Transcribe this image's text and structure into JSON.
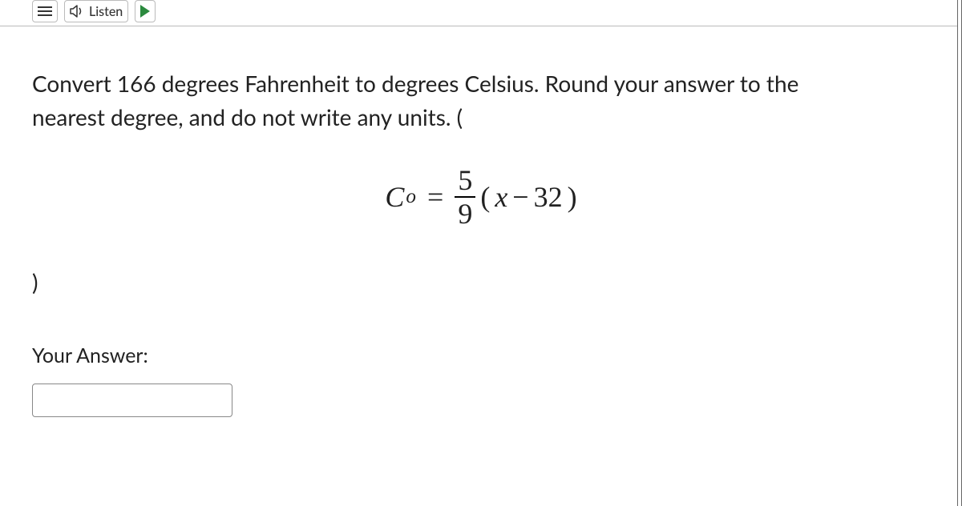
{
  "toolbar": {
    "listen_label": "Listen"
  },
  "question": {
    "line1": "Convert 166 degrees Fahrenheit to degrees Celsius.  Round your answer to the",
    "line2": "nearest degree, and do not write any units.  ("
  },
  "formula": {
    "lhs_var": "C",
    "lhs_sup": "o",
    "eq": "=",
    "frac_num": "5",
    "frac_den": "9",
    "open": "(",
    "inner_var": "x",
    "minus": " − ",
    "const": "32",
    "close": ")"
  },
  "closing_paren": ")",
  "answer_label": "Your Answer:",
  "answer_value": ""
}
